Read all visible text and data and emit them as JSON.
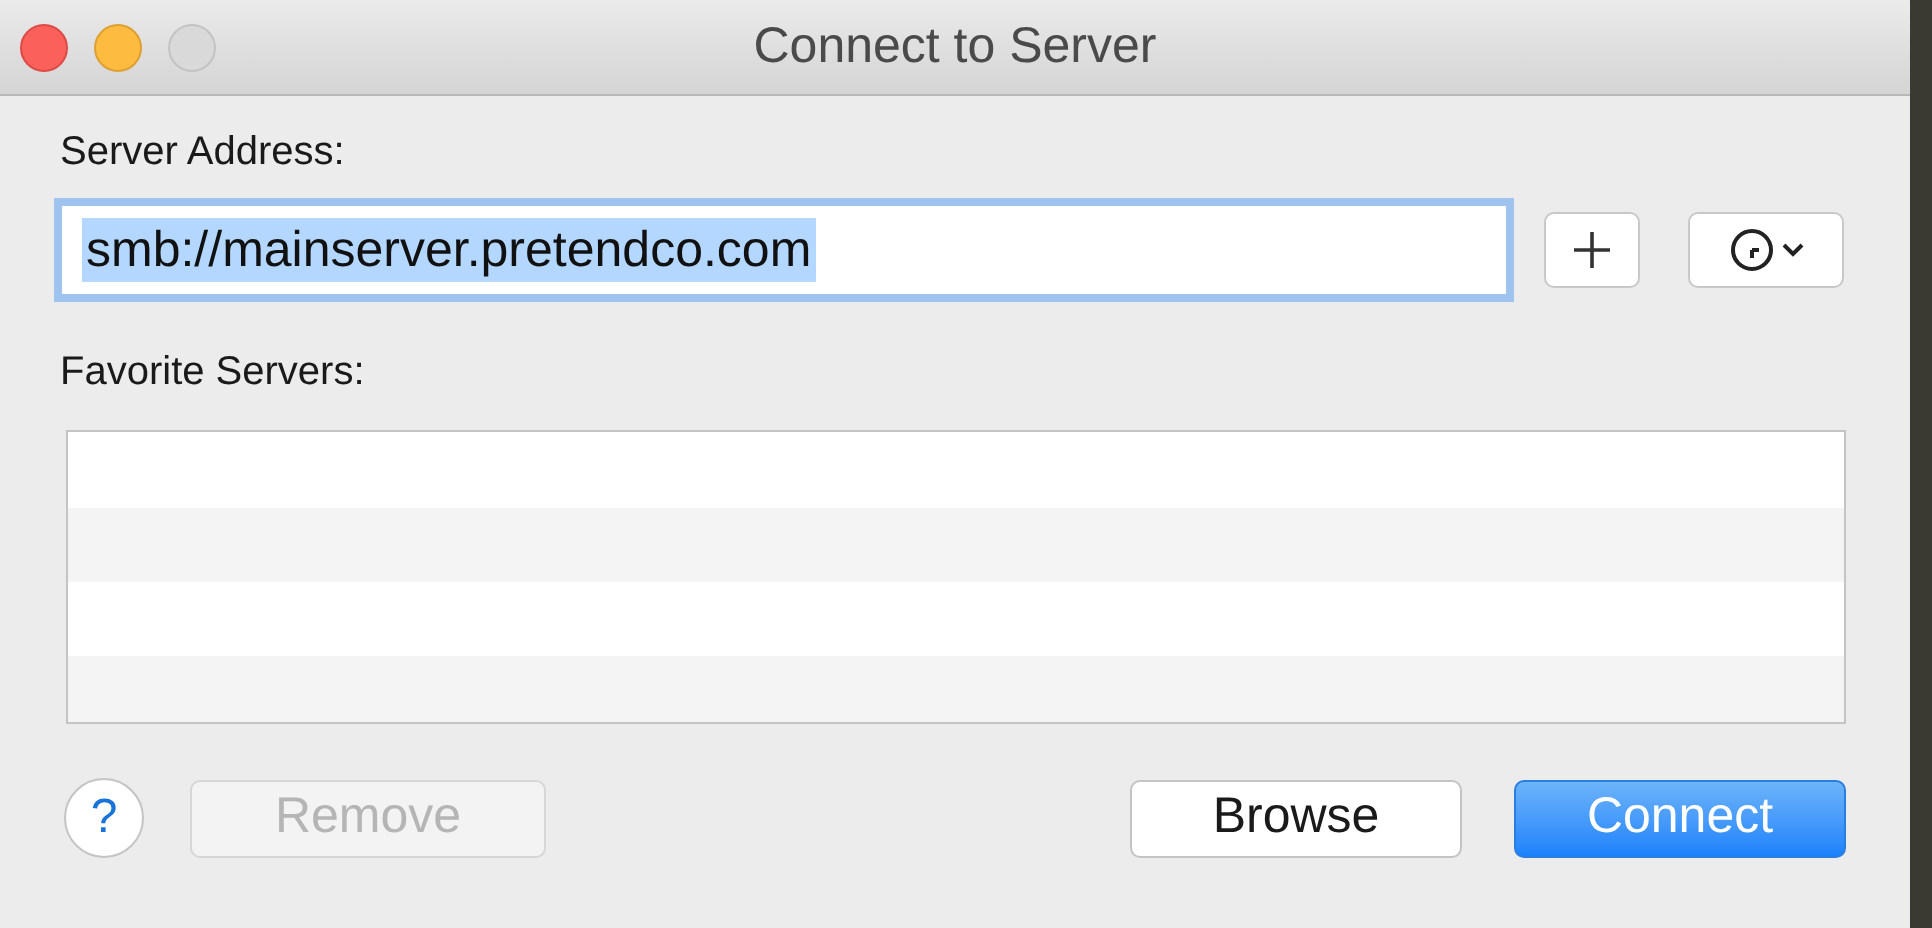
{
  "window": {
    "title": "Connect to Server",
    "controls": [
      {
        "kind": "close",
        "disabled": false
      },
      {
        "kind": "minimize",
        "disabled": false
      },
      {
        "kind": "zoom",
        "disabled": true
      }
    ]
  },
  "server_address": {
    "label": "Server Address:",
    "value": "smb://mainserver.pretendco.com",
    "focused": true,
    "text_selected": true
  },
  "favorite_servers": {
    "label": "Favorite Servers:"
  },
  "buttons": [
    {
      "kind": "help",
      "label": "?"
    },
    {
      "kind": "push",
      "label": "Remove",
      "disabled": true,
      "default": false
    },
    {
      "kind": "push",
      "label": "Browse",
      "disabled": false,
      "default": false
    },
    {
      "kind": "push",
      "label": "Connect",
      "disabled": false,
      "default": true
    }
  ]
}
